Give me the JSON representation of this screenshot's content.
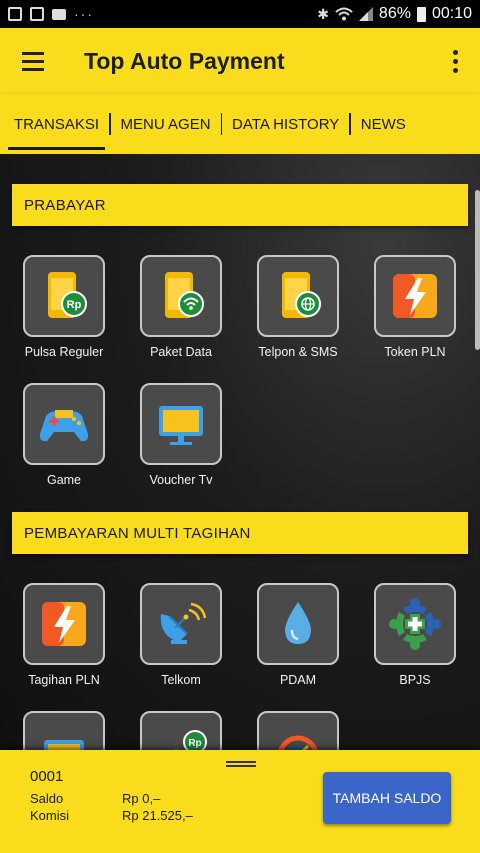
{
  "status_bar": {
    "battery": "86%",
    "time": "00:10",
    "dots": "···"
  },
  "app_bar": {
    "title": "Top Auto Payment"
  },
  "tabs": [
    {
      "label": "TRANSAKSI",
      "active": true
    },
    {
      "label": "MENU AGEN",
      "active": false
    },
    {
      "label": "DATA HISTORY",
      "active": false
    },
    {
      "label": "NEWS",
      "active": false
    }
  ],
  "sections": {
    "prabayar": {
      "title": "PRABAYAR",
      "items": [
        {
          "label": "Pulsa Reguler",
          "icon": "phone-rp-icon"
        },
        {
          "label": "Paket Data",
          "icon": "phone-wifi-icon"
        },
        {
          "label": "Telpon & SMS",
          "icon": "phone-globe-icon"
        },
        {
          "label": "Token PLN",
          "icon": "lightning-icon"
        },
        {
          "label": "Game",
          "icon": "gamepad-icon"
        },
        {
          "label": "Voucher Tv",
          "icon": "tv-icon"
        }
      ]
    },
    "multi": {
      "title": "PEMBAYARAN MULTI TAGIHAN",
      "items": [
        {
          "label": "Tagihan PLN",
          "icon": "lightning-icon"
        },
        {
          "label": "Telkom",
          "icon": "satellite-icon"
        },
        {
          "label": "PDAM",
          "icon": "water-drop-icon"
        },
        {
          "label": "BPJS",
          "icon": "bpjs-icon"
        }
      ],
      "rp_badge": "Rp"
    }
  },
  "bottom": {
    "account": "0001",
    "saldo_label": "Saldo",
    "saldo_value": "Rp 0,–",
    "komisi_label": "Komisi",
    "komisi_value": "Rp 21.525,–",
    "topup_button": "TAMBAH SALDO"
  },
  "colors": {
    "accent": "#f9dc1c",
    "button": "#3a66c9",
    "tile_bg": "#4a4a4a"
  }
}
